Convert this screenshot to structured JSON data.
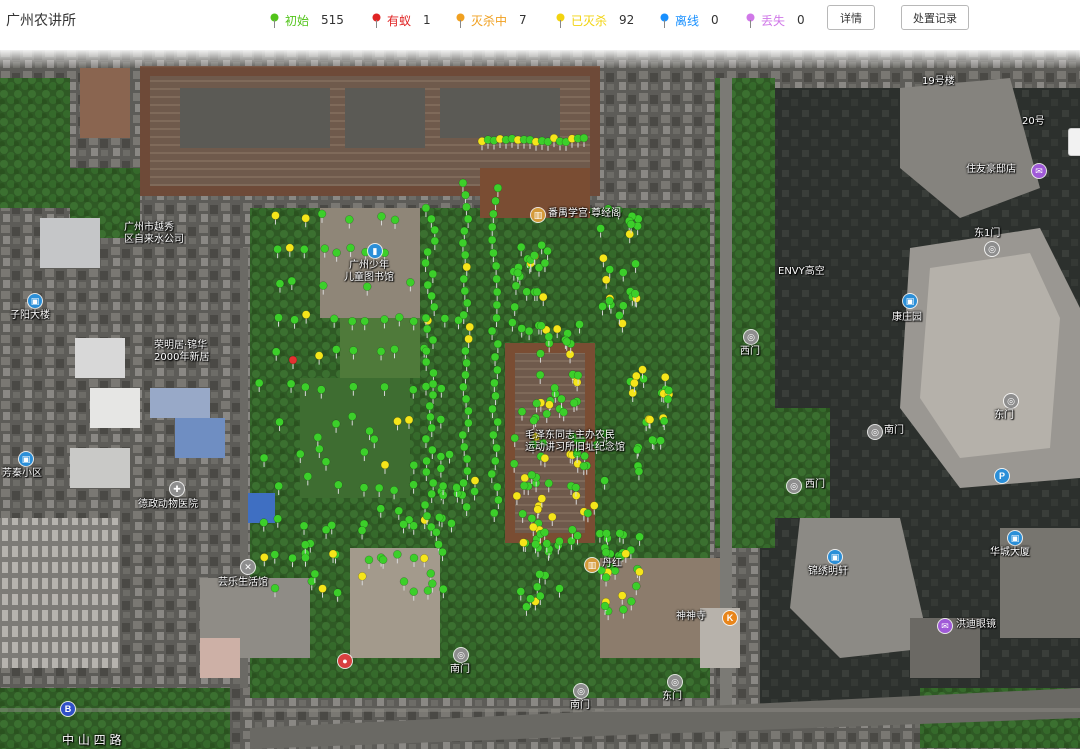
{
  "app": {
    "title": "广州农讲所"
  },
  "statuses": [
    {
      "key": "initial",
      "label": "初始",
      "count": "515",
      "color": "#52c41a"
    },
    {
      "key": "ants",
      "label": "有蚁",
      "count": "1",
      "color": "#e02424"
    },
    {
      "key": "killing",
      "label": "灭杀中",
      "count": "7",
      "color": "#f0a020"
    },
    {
      "key": "killed",
      "label": "已灭杀",
      "count": "92",
      "color": "#f2d30f"
    },
    {
      "key": "offline",
      "label": "离线",
      "count": "0",
      "color": "#1890ff"
    },
    {
      "key": "lost",
      "label": "丢失",
      "count": "0",
      "color": "#d078e8"
    }
  ],
  "buttons": {
    "details": "详情",
    "records": "处置记录"
  },
  "map": {
    "pin_colors": {
      "green": "#3ccf2a",
      "yellow": "#f5e51a",
      "red": "#e53030"
    },
    "pois": [
      {
        "id": "mansion-hotel",
        "name": "住友豪邸店"
      },
      {
        "id": "east-gate-1",
        "name": "东1门"
      },
      {
        "id": "envy-tower",
        "name": "ENVY高空"
      },
      {
        "id": "kangzhuang",
        "name": "康庄园"
      },
      {
        "id": "west-gate",
        "name": "西门"
      },
      {
        "id": "east-gate",
        "name": "东门"
      },
      {
        "id": "south-gate",
        "name": "南门"
      },
      {
        "id": "west-gate-b",
        "name": "西门"
      },
      {
        "id": "east-gate-2",
        "name": "东门"
      },
      {
        "id": "jiangnan-ming",
        "name": "锦绣明轩"
      },
      {
        "id": "huacheng",
        "name": "华城大厦"
      },
      {
        "id": "hongdi",
        "name": "洪迪眼镜"
      },
      {
        "id": "ziyang",
        "name": "子阳大楼"
      },
      {
        "id": "fangqin",
        "name": "芳秦小区"
      },
      {
        "id": "deyi",
        "name": "德政动物医院"
      },
      {
        "id": "shenghuo",
        "name": "芸乐生活馆"
      },
      {
        "id": "children-center",
        "name": "广州少年\n儿童图书馆"
      },
      {
        "id": "district",
        "name": "广州市越秀\n区自来水公司"
      },
      {
        "id": "xiangqiao",
        "name": "番禺学宫·尊经阁"
      },
      {
        "id": "mingshu",
        "name": "荣明居·锦华\n2000年新居"
      },
      {
        "id": "peasant-museum",
        "name": "毛泽东同志主办农民\n运动讲习所旧址纪念馆"
      },
      {
        "id": "danhong",
        "name": "丹红"
      },
      {
        "id": "shenzhen-temple",
        "name": "神神寺"
      },
      {
        "id": "n-gate",
        "name": "19号楼"
      },
      {
        "id": "n2",
        "name": "20号"
      },
      {
        "id": "south-gate-2",
        "name": "南门"
      },
      {
        "id": "south-gate-3",
        "name": "南门"
      },
      {
        "id": "east-gate-3",
        "name": "东门"
      },
      {
        "id": "zhongshan-road",
        "name": "中 山 四 路"
      }
    ]
  }
}
